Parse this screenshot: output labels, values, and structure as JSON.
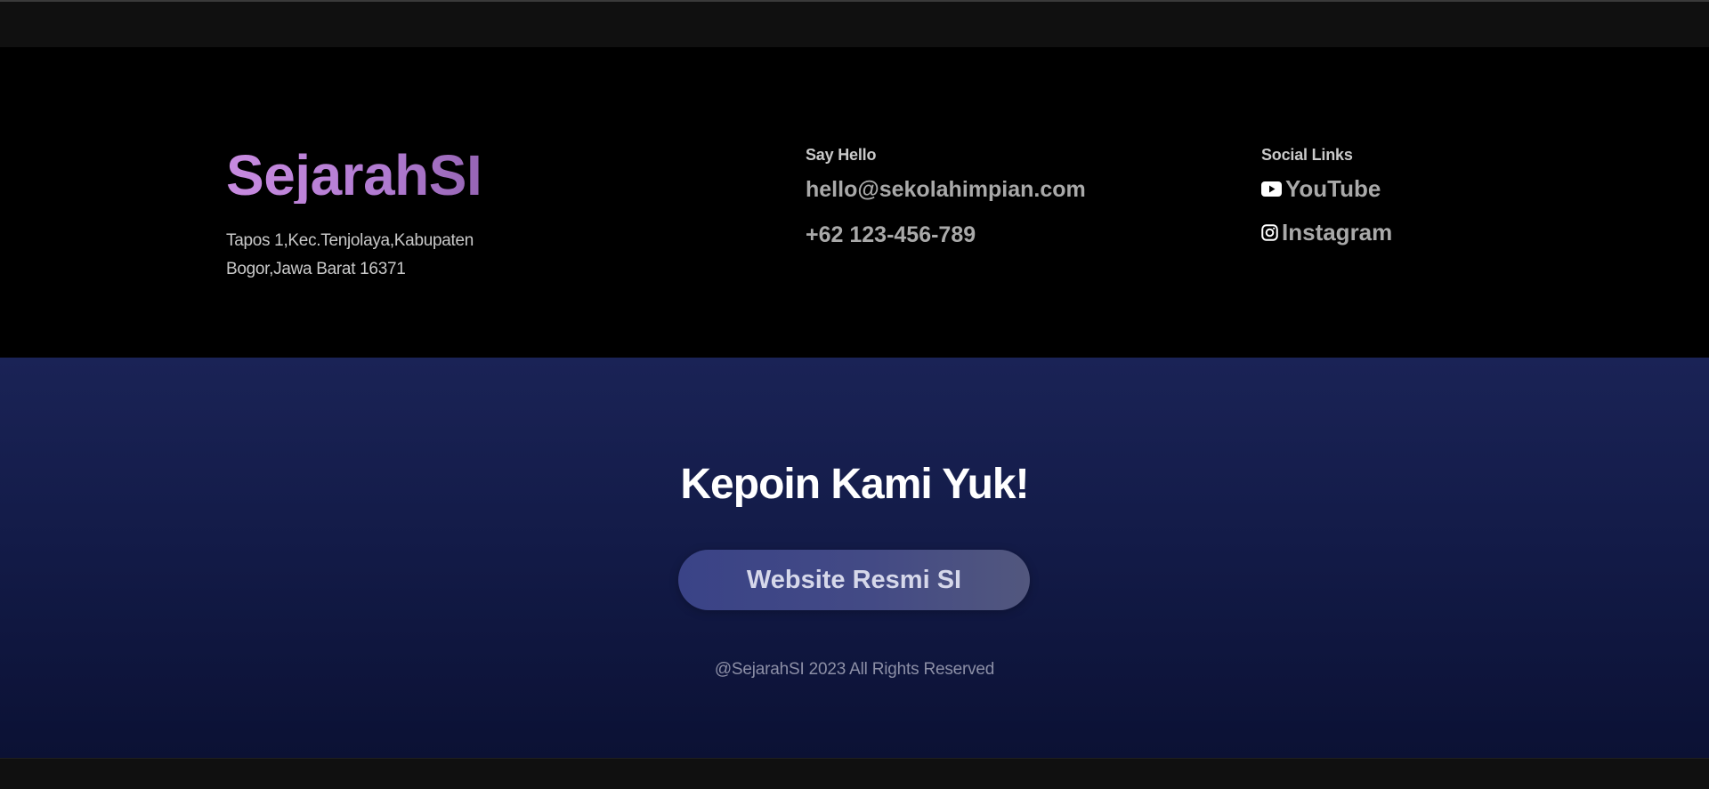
{
  "brand": {
    "title": "SejarahSI",
    "address_line1": "Tapos 1,Kec.Tenjolaya,Kabupaten",
    "address_line2": "Bogor,Jawa Barat 16371"
  },
  "say_hello": {
    "heading": "Say Hello",
    "email": "hello@sekolahimpian.com",
    "phone": "+62 123-456-789"
  },
  "social": {
    "heading": "Social Links",
    "items": [
      {
        "label": "YouTube",
        "icon": "youtube-icon"
      },
      {
        "label": "Instagram",
        "icon": "instagram-icon"
      }
    ]
  },
  "cta": {
    "title": "Kepoin Kami Yuk!",
    "button_label": "Website Resmi SI"
  },
  "copyright": "@SejarahSI 2023 All Rights Reserved",
  "colors": {
    "brand_gradient_start": "#c88be0",
    "brand_gradient_end": "#7a4e96",
    "footer_top_bg": "#000000",
    "footer_bottom_bg": "#141c4a",
    "button_bg": "#434a85"
  }
}
